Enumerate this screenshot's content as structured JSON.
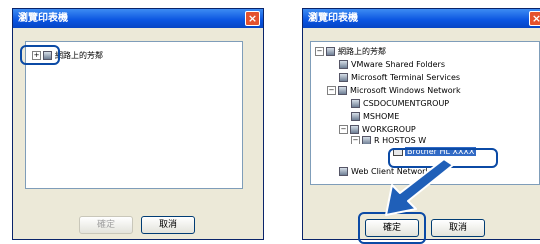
{
  "left_dialog": {
    "title": "瀏覽印表機",
    "close_label": "×",
    "tree_root_label": "網路上的芳鄰",
    "expander": "⊞",
    "ok_label": "確定",
    "cancel_label": "取消"
  },
  "right_dialog": {
    "title": "瀏覽印表機",
    "close_label": "×",
    "tree": {
      "root": "網路上的芳鄰",
      "items": [
        "VMware Shared Folders",
        "Microsoft Terminal Services",
        "Microsoft Windows Network",
        "CSDOCUMENTGROUP",
        "MSHOME",
        "WORKGROUP",
        "R HOSTOS W",
        "Brother HL XXXX",
        "Web Client Network"
      ]
    },
    "expander_minus": "⊟",
    "ok_label": "確定",
    "cancel_label": "取消"
  },
  "colors": {
    "highlight": "#0b4aa5",
    "arrow": "#1f5fb8",
    "selection": "#316ac5"
  }
}
